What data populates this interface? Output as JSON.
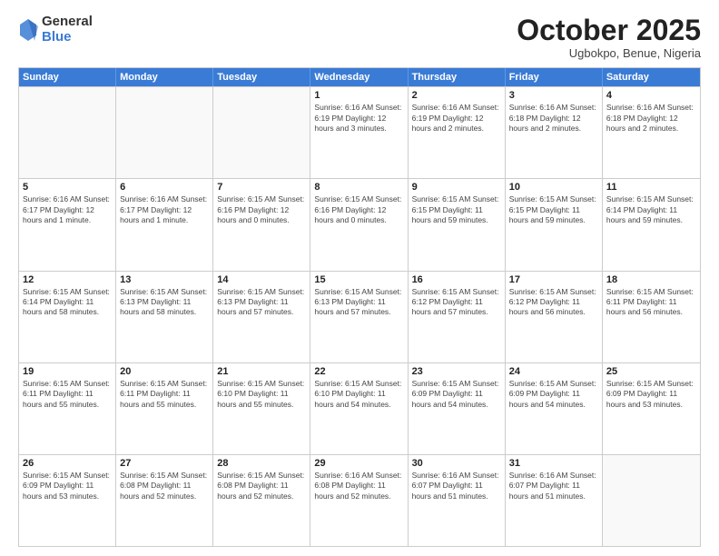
{
  "header": {
    "logo_general": "General",
    "logo_blue": "Blue",
    "month_title": "October 2025",
    "location": "Ugbokpo, Benue, Nigeria"
  },
  "days_of_week": [
    "Sunday",
    "Monday",
    "Tuesday",
    "Wednesday",
    "Thursday",
    "Friday",
    "Saturday"
  ],
  "weeks": [
    [
      {
        "day": "",
        "info": ""
      },
      {
        "day": "",
        "info": ""
      },
      {
        "day": "",
        "info": ""
      },
      {
        "day": "1",
        "info": "Sunrise: 6:16 AM\nSunset: 6:19 PM\nDaylight: 12 hours and 3 minutes."
      },
      {
        "day": "2",
        "info": "Sunrise: 6:16 AM\nSunset: 6:19 PM\nDaylight: 12 hours and 2 minutes."
      },
      {
        "day": "3",
        "info": "Sunrise: 6:16 AM\nSunset: 6:18 PM\nDaylight: 12 hours and 2 minutes."
      },
      {
        "day": "4",
        "info": "Sunrise: 6:16 AM\nSunset: 6:18 PM\nDaylight: 12 hours and 2 minutes."
      }
    ],
    [
      {
        "day": "5",
        "info": "Sunrise: 6:16 AM\nSunset: 6:17 PM\nDaylight: 12 hours and 1 minute."
      },
      {
        "day": "6",
        "info": "Sunrise: 6:16 AM\nSunset: 6:17 PM\nDaylight: 12 hours and 1 minute."
      },
      {
        "day": "7",
        "info": "Sunrise: 6:15 AM\nSunset: 6:16 PM\nDaylight: 12 hours and 0 minutes."
      },
      {
        "day": "8",
        "info": "Sunrise: 6:15 AM\nSunset: 6:16 PM\nDaylight: 12 hours and 0 minutes."
      },
      {
        "day": "9",
        "info": "Sunrise: 6:15 AM\nSunset: 6:15 PM\nDaylight: 11 hours and 59 minutes."
      },
      {
        "day": "10",
        "info": "Sunrise: 6:15 AM\nSunset: 6:15 PM\nDaylight: 11 hours and 59 minutes."
      },
      {
        "day": "11",
        "info": "Sunrise: 6:15 AM\nSunset: 6:14 PM\nDaylight: 11 hours and 59 minutes."
      }
    ],
    [
      {
        "day": "12",
        "info": "Sunrise: 6:15 AM\nSunset: 6:14 PM\nDaylight: 11 hours and 58 minutes."
      },
      {
        "day": "13",
        "info": "Sunrise: 6:15 AM\nSunset: 6:13 PM\nDaylight: 11 hours and 58 minutes."
      },
      {
        "day": "14",
        "info": "Sunrise: 6:15 AM\nSunset: 6:13 PM\nDaylight: 11 hours and 57 minutes."
      },
      {
        "day": "15",
        "info": "Sunrise: 6:15 AM\nSunset: 6:13 PM\nDaylight: 11 hours and 57 minutes."
      },
      {
        "day": "16",
        "info": "Sunrise: 6:15 AM\nSunset: 6:12 PM\nDaylight: 11 hours and 57 minutes."
      },
      {
        "day": "17",
        "info": "Sunrise: 6:15 AM\nSunset: 6:12 PM\nDaylight: 11 hours and 56 minutes."
      },
      {
        "day": "18",
        "info": "Sunrise: 6:15 AM\nSunset: 6:11 PM\nDaylight: 11 hours and 56 minutes."
      }
    ],
    [
      {
        "day": "19",
        "info": "Sunrise: 6:15 AM\nSunset: 6:11 PM\nDaylight: 11 hours and 55 minutes."
      },
      {
        "day": "20",
        "info": "Sunrise: 6:15 AM\nSunset: 6:11 PM\nDaylight: 11 hours and 55 minutes."
      },
      {
        "day": "21",
        "info": "Sunrise: 6:15 AM\nSunset: 6:10 PM\nDaylight: 11 hours and 55 minutes."
      },
      {
        "day": "22",
        "info": "Sunrise: 6:15 AM\nSunset: 6:10 PM\nDaylight: 11 hours and 54 minutes."
      },
      {
        "day": "23",
        "info": "Sunrise: 6:15 AM\nSunset: 6:09 PM\nDaylight: 11 hours and 54 minutes."
      },
      {
        "day": "24",
        "info": "Sunrise: 6:15 AM\nSunset: 6:09 PM\nDaylight: 11 hours and 54 minutes."
      },
      {
        "day": "25",
        "info": "Sunrise: 6:15 AM\nSunset: 6:09 PM\nDaylight: 11 hours and 53 minutes."
      }
    ],
    [
      {
        "day": "26",
        "info": "Sunrise: 6:15 AM\nSunset: 6:09 PM\nDaylight: 11 hours and 53 minutes."
      },
      {
        "day": "27",
        "info": "Sunrise: 6:15 AM\nSunset: 6:08 PM\nDaylight: 11 hours and 52 minutes."
      },
      {
        "day": "28",
        "info": "Sunrise: 6:15 AM\nSunset: 6:08 PM\nDaylight: 11 hours and 52 minutes."
      },
      {
        "day": "29",
        "info": "Sunrise: 6:16 AM\nSunset: 6:08 PM\nDaylight: 11 hours and 52 minutes."
      },
      {
        "day": "30",
        "info": "Sunrise: 6:16 AM\nSunset: 6:07 PM\nDaylight: 11 hours and 51 minutes."
      },
      {
        "day": "31",
        "info": "Sunrise: 6:16 AM\nSunset: 6:07 PM\nDaylight: 11 hours and 51 minutes."
      },
      {
        "day": "",
        "info": ""
      }
    ]
  ],
  "colors": {
    "header_bg": "#3a7bd5",
    "header_text": "#ffffff"
  }
}
